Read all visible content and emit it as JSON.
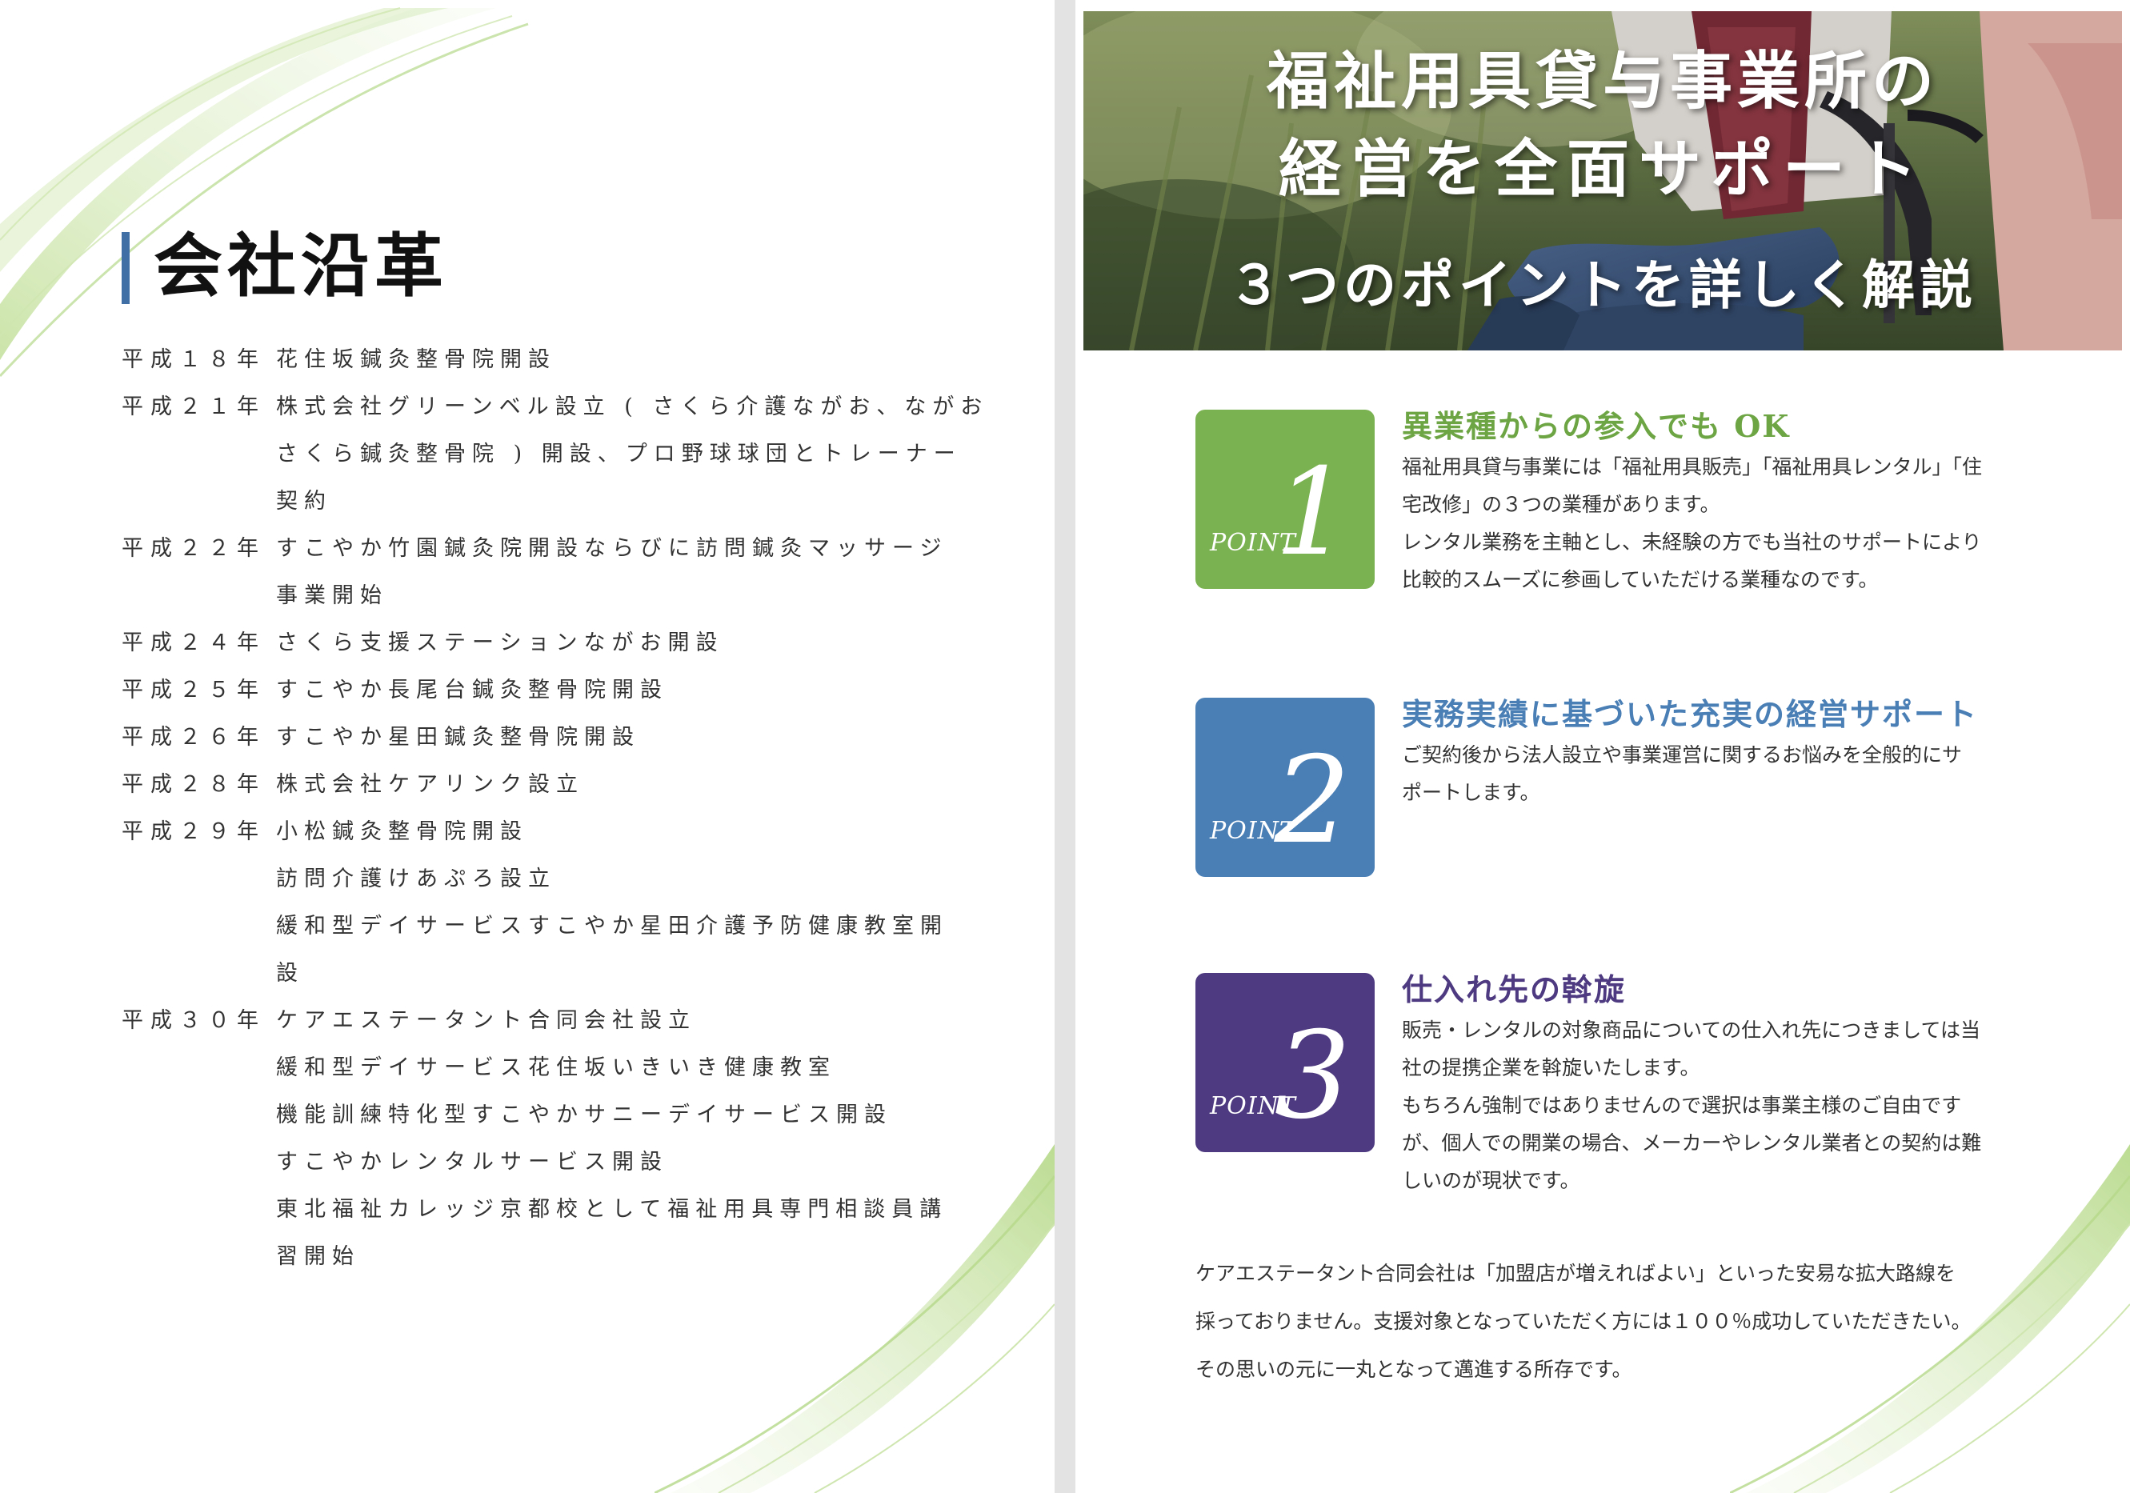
{
  "left_page": {
    "title": "会社沿革",
    "history": [
      {
        "year": "平成１８年",
        "lines": [
          "花住坂鍼灸整骨院開設"
        ]
      },
      {
        "year": "平成２１年",
        "lines": [
          "株式会社グリーンベル設立 ( さくら介護ながお、ながお",
          "さくら鍼灸整骨院 ) 開設、プロ野球球団とトレーナー",
          "契約"
        ]
      },
      {
        "year": "平成２２年",
        "lines": [
          "すこやか竹園鍼灸院開設ならびに訪問鍼灸マッサージ",
          "事業開始"
        ]
      },
      {
        "year": "平成２４年",
        "lines": [
          "さくら支援ステーションながお開設"
        ]
      },
      {
        "year": "平成２５年",
        "lines": [
          "すこやか長尾台鍼灸整骨院開設"
        ]
      },
      {
        "year": "平成２６年",
        "lines": [
          "すこやか星田鍼灸整骨院開設"
        ]
      },
      {
        "year": "平成２８年",
        "lines": [
          "株式会社ケアリンク設立"
        ]
      },
      {
        "year": "平成２９年",
        "lines": [
          "小松鍼灸整骨院開設",
          "訪問介護けあぷろ設立",
          "緩和型デイサービスすこやか星田介護予防健康教室開",
          "設"
        ]
      },
      {
        "year": "平成３０年",
        "lines": [
          "ケアエステータント合同会社設立",
          "緩和型デイサービス花住坂いきいき健康教室",
          "機能訓練特化型すこやかサニーデイサービス開設",
          "すこやかレンタルサービス開設",
          "東北福祉カレッジ京都校として福祉用具専門相談員講",
          "習開始"
        ]
      }
    ]
  },
  "right_page": {
    "hero": {
      "line1": "福祉用具貸与事業所の",
      "line2": "経営を全面サポート",
      "line3": "３つのポイントを詳しく解説"
    },
    "points": [
      {
        "label": "POINT",
        "number": "1",
        "color": "#7bb251",
        "heading_color": "#6ea544",
        "heading": "異業種からの参入でも OK",
        "lines": [
          "福祉用具貸与事業には「福祉用具販売」「福祉用具レンタル」「住",
          "宅改修」の３つの業種があります。",
          "レンタル業務を主軸とし、未経験の方でも当社のサポートにより",
          "比較的スムーズに参画していただける業種なのです。"
        ]
      },
      {
        "label": "POINT",
        "number": "2",
        "color": "#4a7fb6",
        "heading_color": "#4a7fb6",
        "heading": "実務実績に基づいた充実の経営サポート",
        "lines": [
          "ご契約後から法人設立や事業運営に関するお悩みを全般的にサ",
          "ポートします。"
        ]
      },
      {
        "label": "POINT",
        "number": "3",
        "color": "#4d3a80",
        "heading_color": "#4d3a80",
        "heading": "仕入れ先の斡旋",
        "lines": [
          "販売・レンタルの対象商品についての仕入れ先につきましては当",
          "社の提携企業を斡旋いたします。",
          "もちろん強制ではありませんので選択は事業主様のご自由です",
          "が、個人での開業の場合、メーカーやレンタル業者との契約は難",
          "しいのが現状です。"
        ]
      }
    ],
    "closing": [
      "ケアエステータント合同会社は「加盟店が増えればよい」といった安易な拡大路線を",
      "採っておりません。支援対象となっていただく方には１００％成功していただきたい。",
      "その思いの元に一丸となって邁進する所存です。"
    ]
  }
}
